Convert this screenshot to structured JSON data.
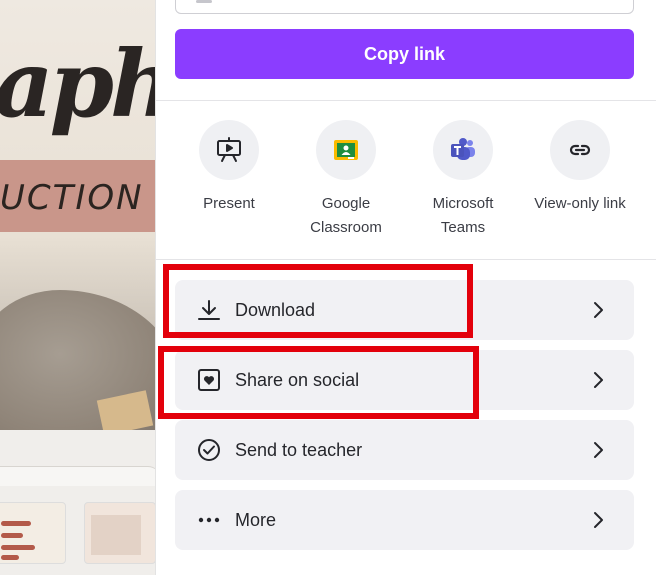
{
  "canvas": {
    "script_text": "aph",
    "strip_text": "UCTION"
  },
  "share_panel": {
    "copy_button_label": "Copy link",
    "options": [
      {
        "label_line1": "Present",
        "label_line2": "",
        "icon": "present-icon"
      },
      {
        "label_line1": "Google",
        "label_line2": "Classroom",
        "icon": "google-classroom-icon"
      },
      {
        "label_line1": "Microsoft",
        "label_line2": "Teams",
        "icon": "microsoft-teams-icon"
      },
      {
        "label_line1": "View-only link",
        "label_line2": "",
        "icon": "link-icon"
      }
    ],
    "rows": [
      {
        "label": "Download",
        "icon": "download-icon"
      },
      {
        "label": "Share on social",
        "icon": "heart-card-icon"
      },
      {
        "label": "Send to teacher",
        "icon": "check-circle-icon"
      },
      {
        "label": "More",
        "icon": "more-dots-icon"
      }
    ]
  },
  "colors": {
    "accent": "#8b3dff",
    "highlight": "#e3000b",
    "row_bg": "#f1f1f4"
  }
}
